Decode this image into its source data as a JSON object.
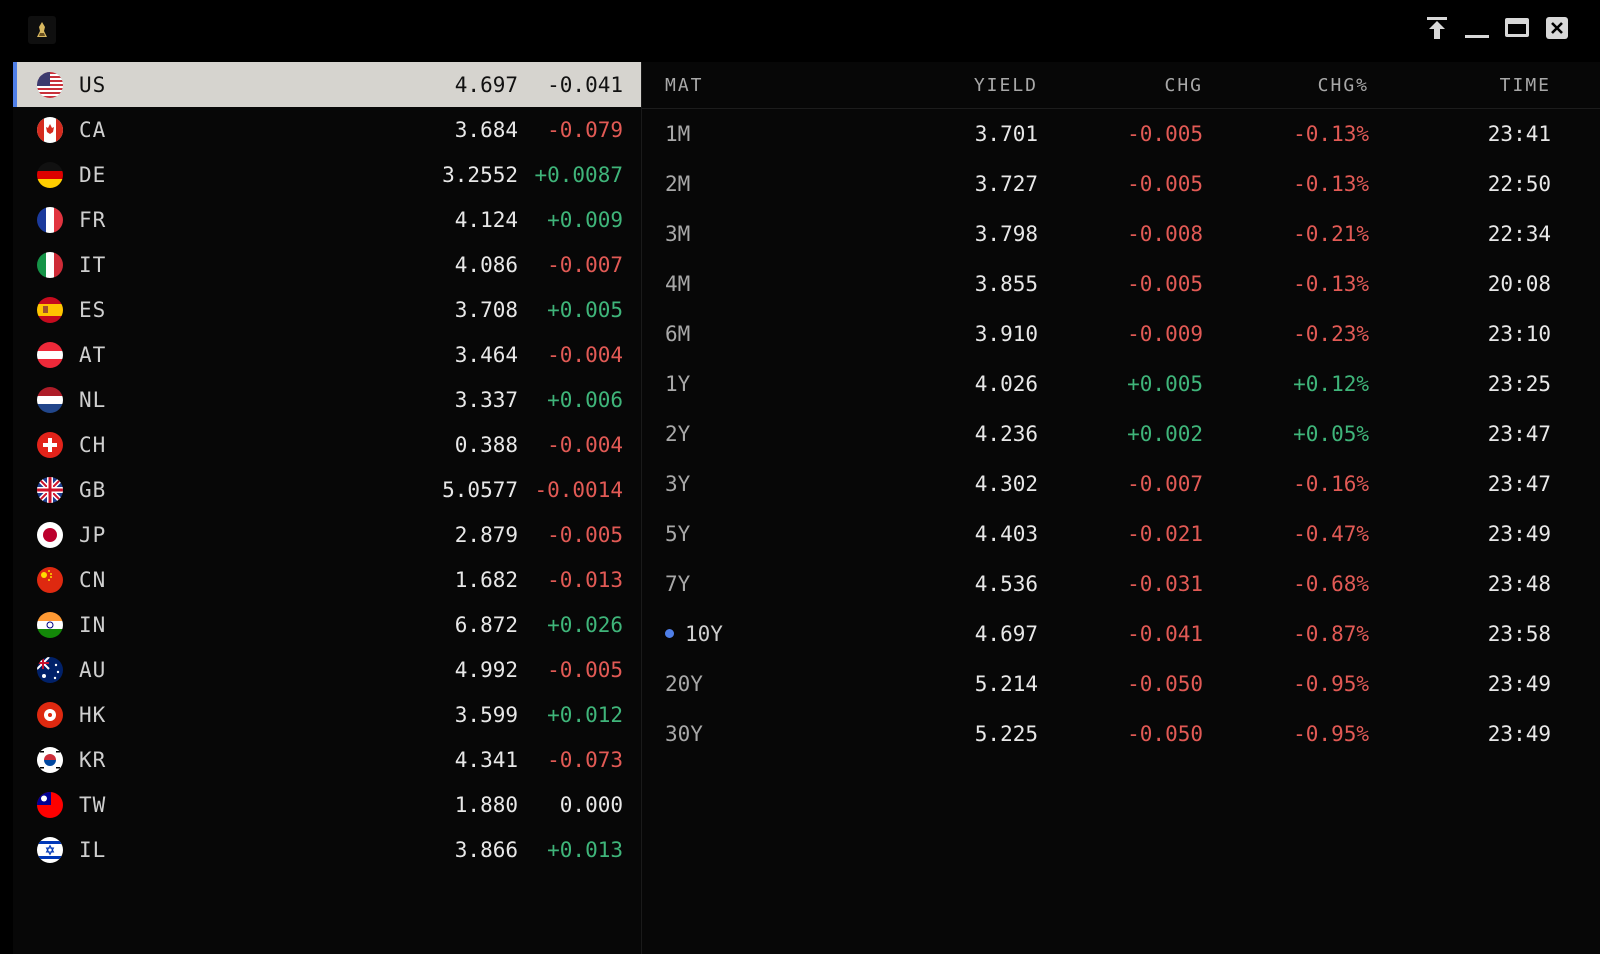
{
  "window": {
    "controls": [
      "pin-icon",
      "minimize-icon",
      "maximize-icon",
      "close-icon"
    ]
  },
  "countries": [
    {
      "code": "US",
      "yield": "4.697",
      "chg": "-0.041",
      "dir": "neg",
      "selected": true
    },
    {
      "code": "CA",
      "yield": "3.684",
      "chg": "-0.079",
      "dir": "neg"
    },
    {
      "code": "DE",
      "yield": "3.2552",
      "chg": "+0.0087",
      "dir": "pos"
    },
    {
      "code": "FR",
      "yield": "4.124",
      "chg": "+0.009",
      "dir": "pos"
    },
    {
      "code": "IT",
      "yield": "4.086",
      "chg": "-0.007",
      "dir": "neg"
    },
    {
      "code": "ES",
      "yield": "3.708",
      "chg": "+0.005",
      "dir": "pos"
    },
    {
      "code": "AT",
      "yield": "3.464",
      "chg": "-0.004",
      "dir": "neg"
    },
    {
      "code": "NL",
      "yield": "3.337",
      "chg": "+0.006",
      "dir": "pos"
    },
    {
      "code": "CH",
      "yield": "0.388",
      "chg": "-0.004",
      "dir": "neg"
    },
    {
      "code": "GB",
      "yield": "5.0577",
      "chg": "-0.0014",
      "dir": "neg"
    },
    {
      "code": "JP",
      "yield": "2.879",
      "chg": "-0.005",
      "dir": "neg"
    },
    {
      "code": "CN",
      "yield": "1.682",
      "chg": "-0.013",
      "dir": "neg"
    },
    {
      "code": "IN",
      "yield": "6.872",
      "chg": "+0.026",
      "dir": "pos"
    },
    {
      "code": "AU",
      "yield": "4.992",
      "chg": "-0.005",
      "dir": "neg"
    },
    {
      "code": "HK",
      "yield": "3.599",
      "chg": "+0.012",
      "dir": "pos"
    },
    {
      "code": "KR",
      "yield": "4.341",
      "chg": "-0.073",
      "dir": "neg"
    },
    {
      "code": "TW",
      "yield": "1.880",
      "chg": "0.000",
      "dir": "zero"
    },
    {
      "code": "IL",
      "yield": "3.866",
      "chg": "+0.013",
      "dir": "pos"
    }
  ],
  "table": {
    "headers": {
      "mat": "MAT",
      "yield": "YIELD",
      "chg": "CHG",
      "chg_pct": "CHG%",
      "time": "TIME"
    },
    "rows": [
      {
        "mat": "1M",
        "yield": "3.701",
        "chg": "-0.005",
        "pct": "-0.13%",
        "time": "23:41",
        "dir": "neg"
      },
      {
        "mat": "2M",
        "yield": "3.727",
        "chg": "-0.005",
        "pct": "-0.13%",
        "time": "22:50",
        "dir": "neg"
      },
      {
        "mat": "3M",
        "yield": "3.798",
        "chg": "-0.008",
        "pct": "-0.21%",
        "time": "22:34",
        "dir": "neg"
      },
      {
        "mat": "4M",
        "yield": "3.855",
        "chg": "-0.005",
        "pct": "-0.13%",
        "time": "20:08",
        "dir": "neg"
      },
      {
        "mat": "6M",
        "yield": "3.910",
        "chg": "-0.009",
        "pct": "-0.23%",
        "time": "23:10",
        "dir": "neg"
      },
      {
        "mat": "1Y",
        "yield": "4.026",
        "chg": "+0.005",
        "pct": "+0.12%",
        "time": "23:25",
        "dir": "pos"
      },
      {
        "mat": "2Y",
        "yield": "4.236",
        "chg": "+0.002",
        "pct": "+0.05%",
        "time": "23:47",
        "dir": "pos"
      },
      {
        "mat": "3Y",
        "yield": "4.302",
        "chg": "-0.007",
        "pct": "-0.16%",
        "time": "23:47",
        "dir": "neg"
      },
      {
        "mat": "5Y",
        "yield": "4.403",
        "chg": "-0.021",
        "pct": "-0.47%",
        "time": "23:49",
        "dir": "neg"
      },
      {
        "mat": "7Y",
        "yield": "4.536",
        "chg": "-0.031",
        "pct": "-0.68%",
        "time": "23:48",
        "dir": "neg"
      },
      {
        "mat": "10Y",
        "yield": "4.697",
        "chg": "-0.041",
        "pct": "-0.87%",
        "time": "23:58",
        "dir": "neg",
        "current": true
      },
      {
        "mat": "20Y",
        "yield": "5.214",
        "chg": "-0.050",
        "pct": "-0.95%",
        "time": "23:49",
        "dir": "neg"
      },
      {
        "mat": "30Y",
        "yield": "5.225",
        "chg": "-0.050",
        "pct": "-0.95%",
        "time": "23:49",
        "dir": "neg"
      }
    ]
  },
  "colors": {
    "negative": "#e25a55",
    "positive": "#3fb57a",
    "accent": "#4f7fe8",
    "selected_row": "#d6d4cf"
  }
}
